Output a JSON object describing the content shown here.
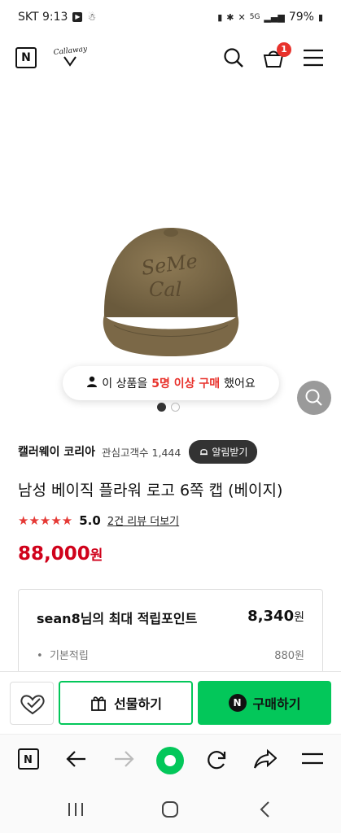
{
  "status": {
    "carrier_time": "SKT 9:13",
    "battery": "79%"
  },
  "header": {
    "logo": "N",
    "brand": "Callaway",
    "cart_count": "1"
  },
  "image_overlay": {
    "prefix": "이 상품을",
    "highlight": "5명 이상 구매",
    "suffix": "했어요"
  },
  "store": {
    "name": "캘러웨이 코리아",
    "favorites": "관심고객수 1,444",
    "alarm": "알림받기"
  },
  "product": {
    "title": "남성 베이직 플라워 로고 6쪽 캡 (베이지)",
    "stars": "★★★★★",
    "score": "5.0",
    "review_link": "2건 리뷰 더보기",
    "price": "88,000",
    "price_unit": "원"
  },
  "points": {
    "title": "sean8님의 최대 적립포인트",
    "value": "8,340",
    "unit": "원",
    "sub_label": "기본적립",
    "sub_value": "880원"
  },
  "actions": {
    "gift": "선물하기",
    "buy": "구매하기",
    "buy_icon": "N"
  },
  "colors": {
    "accent_green": "#03c75a",
    "price_red": "#d0021b",
    "badge_red": "#e8322c"
  }
}
